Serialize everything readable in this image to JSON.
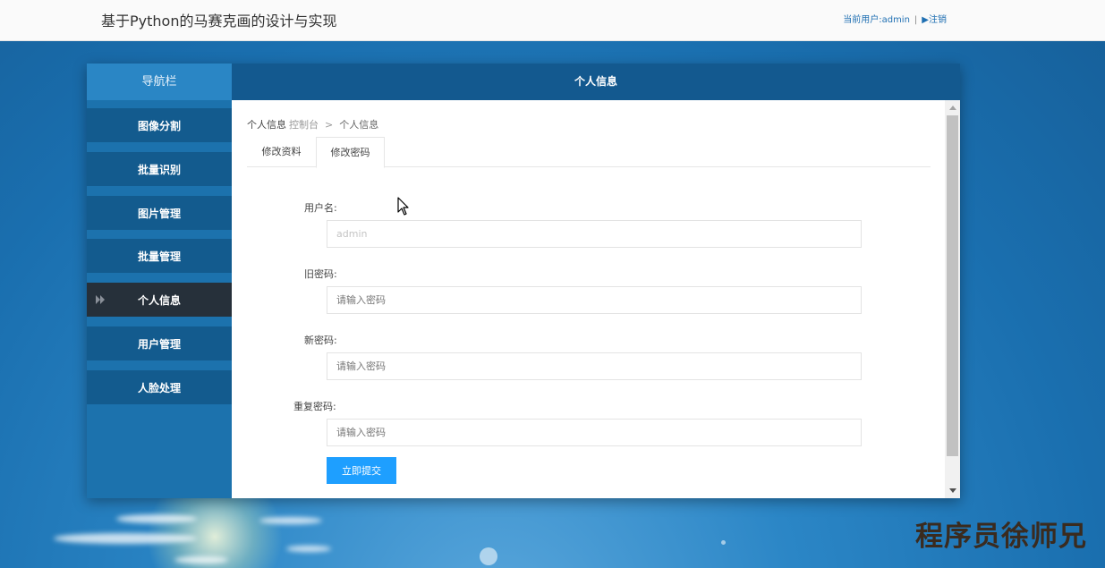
{
  "header": {
    "title": "基于Python的马赛克画的设计与实现",
    "user_label": "当前用户:admin",
    "separator": "|",
    "logout_label": "▶注销"
  },
  "sidebar": {
    "title": "导航栏",
    "items": [
      {
        "label": "图像分割",
        "active": false
      },
      {
        "label": "批量识别",
        "active": false
      },
      {
        "label": "图片管理",
        "active": false
      },
      {
        "label": "批量管理",
        "active": false
      },
      {
        "label": "个人信息",
        "active": true
      },
      {
        "label": "用户管理",
        "active": false
      },
      {
        "label": "人脸处理",
        "active": false
      }
    ]
  },
  "content": {
    "header_title": "个人信息",
    "breadcrumb": {
      "current": "个人信息",
      "link": "控制台",
      "separator": ">",
      "page": "个人信息"
    },
    "tabs": [
      {
        "label": "修改资料",
        "active": false
      },
      {
        "label": "修改密码",
        "active": true
      }
    ],
    "form": {
      "username_label": "用户名:",
      "username_value": "admin",
      "old_password_label": "旧密码:",
      "old_password_placeholder": "请输入密码",
      "new_password_label": "新密码:",
      "new_password_placeholder": "请输入密码",
      "repeat_password_label": "重复密码:",
      "repeat_password_placeholder": "请输入密码",
      "submit_label": "立即提交"
    }
  },
  "watermark": "程序员徐师兄",
  "colors": {
    "accent": "#1e9fff",
    "sidebar_item": "#135b8e",
    "sidebar_active": "#26303a",
    "content_header": "#13598f"
  },
  "icons": {
    "nav_active": "double-arrow-icon",
    "cursor": "mouse-pointer-icon"
  }
}
